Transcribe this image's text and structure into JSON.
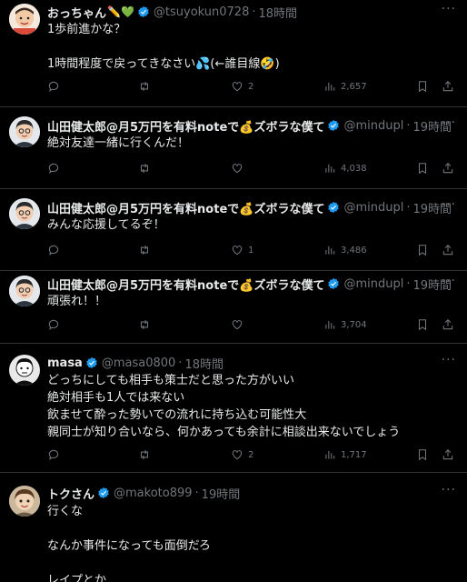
{
  "tweets": [
    {
      "name": "おっちゃん",
      "handle": "@tsuyokun0728",
      "time": "18時間",
      "text": "1歩前進かな？\n\n1時間程度で戻ってきなさい💦(←誰目線🤣)",
      "replies": "",
      "retweets": "",
      "likes": "2",
      "views": "2,657"
    },
    {
      "name": "山田健太郎@月5万円を有料noteで💰ズボラな僕て",
      "handle": "@mindupl",
      "time": "19時間",
      "text": "絶対友達一緒に行くんだ！",
      "replies": "",
      "retweets": "",
      "likes": "",
      "views": "4,038"
    },
    {
      "name": "山田健太郎@月5万円を有料noteで💰ズボラな僕て",
      "handle": "@mindupl",
      "time": "19時間",
      "text": "みんな応援してるぞ！",
      "replies": "",
      "retweets": "",
      "likes": "1",
      "views": "3,486"
    },
    {
      "name": "山田健太郎@月5万円を有料noteで💰ズボラな僕て",
      "handle": "@mindupl",
      "time": "19時間",
      "text": "頑張れ！！",
      "replies": "",
      "retweets": "",
      "likes": "",
      "views": "3,704"
    },
    {
      "name": "masa",
      "handle": "@masa0800",
      "time": "18時間",
      "text": "どっちにしても相手も策士だと思った方がいい\n絶対相手も1人では来ない\n飲ませて酔った勢いでの流れに持ち込む可能性大\n親同士が知り合いなら、何かあっても余計に相談出来ないでしょう",
      "replies": "",
      "retweets": "",
      "likes": "2",
      "views": "1,717"
    },
    {
      "name": "トクさん",
      "handle": "@makoto899",
      "time": "19時間",
      "text": "行くな\n\nなんか事件になっても面倒だろ\n\nレイプとか",
      "replies": "",
      "retweets": "",
      "likes": "",
      "views": ""
    }
  ],
  "colors": {
    "background": "#000000",
    "text": "#e7e9ea",
    "muted": "#71767b",
    "verified": "#1d9bf0",
    "divider": "#2f3336"
  },
  "first_tweet_name_emojis": "✏️💚",
  "icons": [
    "reply-icon",
    "retweet-icon",
    "like-icon",
    "views-icon",
    "bookmark-icon",
    "share-icon",
    "verified-badge-icon",
    "more-icon"
  ]
}
